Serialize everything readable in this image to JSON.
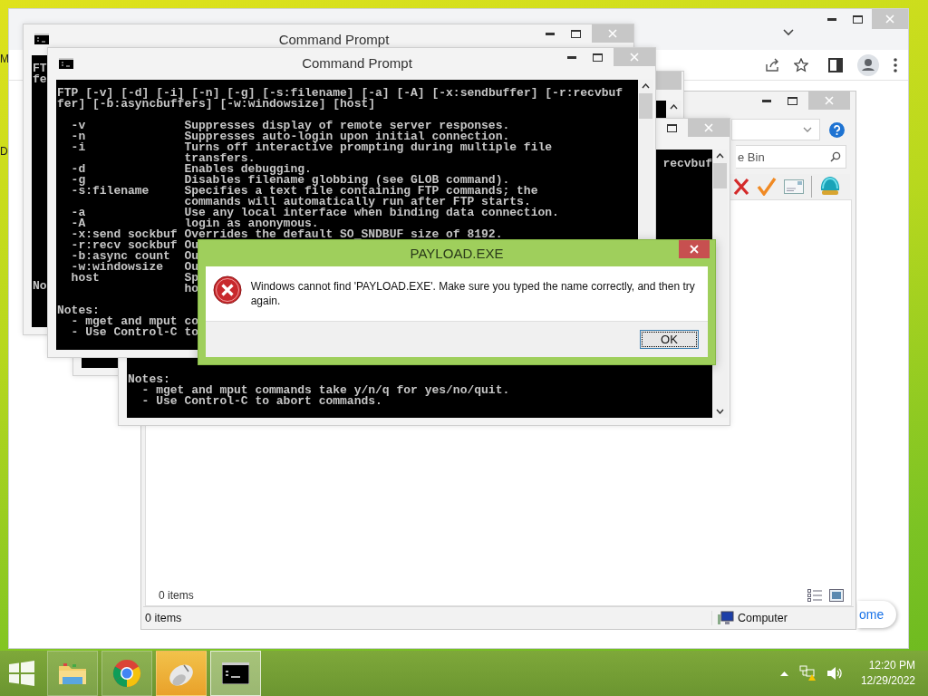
{
  "desktop": {
    "icon_labels": [
      "M",
      "D"
    ]
  },
  "browser_window": {
    "floating_button": {
      "label": "ome"
    }
  },
  "explorer_window": {
    "search": {
      "placeholder": "e Bin"
    },
    "content_status": "0 items",
    "status_bar": {
      "items": "0 items",
      "location": "Computer"
    }
  },
  "console_back": {
    "title": "Command Prompt",
    "top_lines": [
      "FT",
      "fe"
    ],
    "bottom_line": "No"
  },
  "console_lower": {
    "line_end": "recvbuf",
    "notes": {
      "heading": "Notes:",
      "items": [
        "- mget and mput commands take y/n/q for yes/no/quit.",
        "- Use Control-C to abort commands."
      ]
    }
  },
  "console_front": {
    "title": "Command Prompt",
    "usage": [
      "FTP [-v] [-d] [-i] [-n] [-g] [-s:filename] [-a] [-A] [-x:sendbuffer] [-r:recvbuf",
      "fer] [-b:asyncbuffers] [-w:windowsize] [host]"
    ],
    "options": [
      {
        "flag": "-v",
        "text": "Suppresses display of remote server responses."
      },
      {
        "flag": "-n",
        "text": "Suppresses auto-login upon initial connection."
      },
      {
        "flag": "-i",
        "text": "Turns off interactive prompting during multiple file"
      },
      {
        "text": "transfers."
      },
      {
        "flag": "-d",
        "text": "Enables debugging."
      },
      {
        "flag": "-g",
        "text": "Disables filename globbing (see GLOB command)."
      },
      {
        "flag": "-s:filename",
        "text": "Specifies a text file containing FTP commands; the"
      },
      {
        "text": "commands will automatically run after FTP starts."
      },
      {
        "flag": "-a",
        "text": "Use any local interface when binding data connection."
      },
      {
        "flag": "-A",
        "text": "login as anonymous."
      },
      {
        "flag": "-x:send sockbuf",
        "text": "Overrides the default SO_SNDBUF size of 8192."
      },
      {
        "flag": "-r:recv sockbuf",
        "text": "Ou"
      },
      {
        "flag": "-b:async count",
        "text": "Ou"
      },
      {
        "flag": "-w:windowsize",
        "text": "Ou"
      },
      {
        "flag": "host",
        "text": "Sp"
      },
      {
        "text": "ho"
      }
    ],
    "notes": {
      "heading": "Notes:",
      "items": [
        "- mget and mput co",
        "- Use Control-C to"
      ]
    }
  },
  "dialog": {
    "title": "PAYLOAD.EXE",
    "message": "Windows cannot find 'PAYLOAD.EXE'. Make sure you typed the name correctly, and then try again.",
    "button": {
      "label": "OK",
      "focused": true
    }
  },
  "taskbar": {
    "apps": [
      {
        "kind": "folder",
        "highlighted": false,
        "active": false
      },
      {
        "kind": "browser",
        "highlighted": false,
        "active": false
      },
      {
        "kind": "mouse",
        "highlighted": true,
        "active": false
      },
      {
        "kind": "console",
        "highlighted": false,
        "active": true
      }
    ],
    "clock": {
      "time": "12:20 PM",
      "date": "12/29/2022"
    }
  }
}
